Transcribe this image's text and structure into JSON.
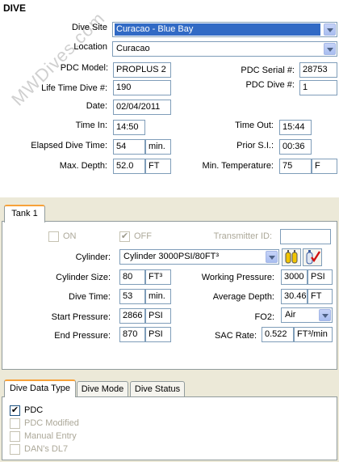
{
  "section_title": "DIVE",
  "watermark": "MWDives.com",
  "dive": {
    "dive_site_label": "Dive Site",
    "dive_site_value": "Curacao - Blue Bay",
    "location_label": "Location",
    "location_value": "Curacao",
    "pdc_model_label": "PDC Model:",
    "pdc_model_value": "PROPLUS 2",
    "pdc_serial_label": "PDC Serial #:",
    "pdc_serial_value": "28753",
    "lifetime_dive_label": "Life Time Dive #:",
    "lifetime_dive_value": "190",
    "pdc_dive_label": "PDC Dive #:",
    "pdc_dive_value": "1",
    "date_label": "Date:",
    "date_value": "02/04/2011",
    "time_in_label": "Time In:",
    "time_in_value": "14:50",
    "time_out_label": "Time Out:",
    "time_out_value": "15:44",
    "elapsed_label": "Elapsed Dive Time:",
    "elapsed_value": "54",
    "elapsed_unit": "min.",
    "prior_si_label": "Prior S.I.:",
    "prior_si_value": "00:36",
    "max_depth_label": "Max. Depth:",
    "max_depth_value": "52.0",
    "max_depth_unit": "FT",
    "min_temp_label": "Min. Temperature:",
    "min_temp_value": "75",
    "min_temp_unit": "F"
  },
  "tank": {
    "tab_label": "Tank 1",
    "on_label": "ON",
    "off_label": "OFF",
    "on_checked": false,
    "off_checked": true,
    "transmitter_label": "Transmitter ID:",
    "transmitter_value": "",
    "cylinder_label": "Cylinder:",
    "cylinder_value": "Cylinder 3000PSI/80FT³",
    "cylinder_size_label": "Cylinder Size:",
    "cylinder_size_value": "80",
    "cylinder_size_unit": "FT³",
    "working_pressure_label": "Working Pressure:",
    "working_pressure_value": "3000",
    "working_pressure_unit": "PSI",
    "dive_time_label": "Dive Time:",
    "dive_time_value": "53",
    "dive_time_unit": "min.",
    "avg_depth_label": "Average Depth:",
    "avg_depth_value": "30.46",
    "avg_depth_unit": "FT",
    "start_pressure_label": "Start Pressure:",
    "start_pressure_value": "2866",
    "start_pressure_unit": "PSI",
    "fo2_label": "FO2:",
    "fo2_value": "Air",
    "end_pressure_label": "End Pressure:",
    "end_pressure_value": "870",
    "end_pressure_unit": "PSI",
    "sac_label": "SAC Rate:",
    "sac_value": "0.522",
    "sac_unit": "FT³/min"
  },
  "bottom_tabs": [
    "Dive Data Type",
    "Dive Mode",
    "Dive Status"
  ],
  "data_types": [
    {
      "label": "PDC",
      "checked": true,
      "enabled": true
    },
    {
      "label": "PDC Modified",
      "checked": false,
      "enabled": false
    },
    {
      "label": "Manual Entry",
      "checked": false,
      "enabled": false
    },
    {
      "label": "DAN's DL7",
      "checked": false,
      "enabled": false
    }
  ]
}
